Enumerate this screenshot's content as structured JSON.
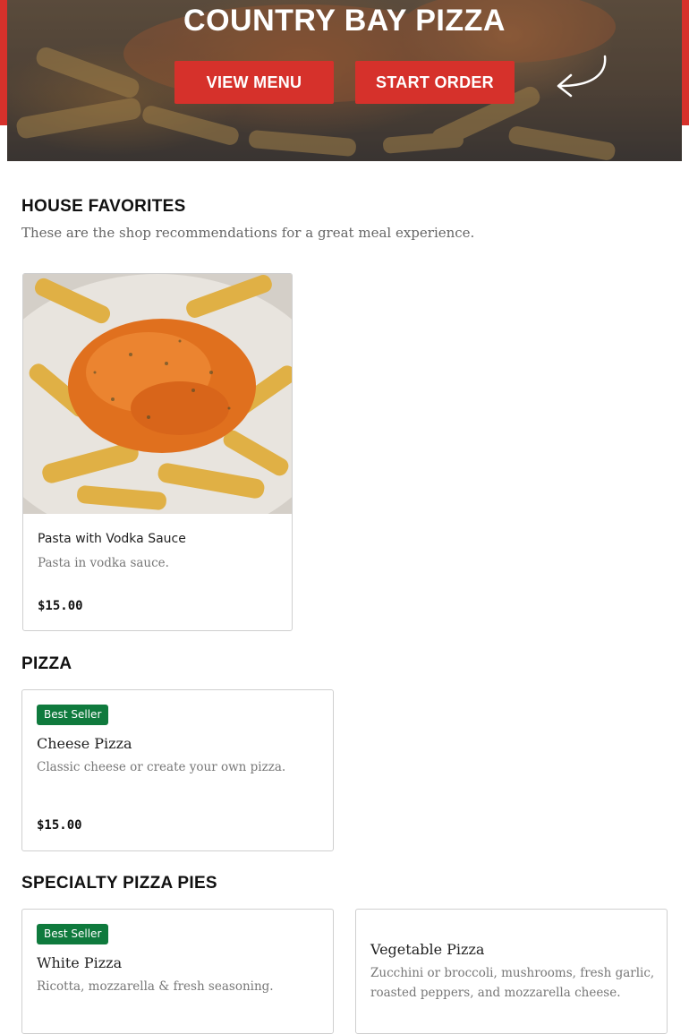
{
  "hero": {
    "title": "COUNTRY BAY PIZZA",
    "view_menu_label": "VIEW MENU",
    "start_order_label": "START ORDER"
  },
  "house_favorites": {
    "title": "HOUSE FAVORITES",
    "subtitle": "These are the shop recommendations for a great meal experience.",
    "items": [
      {
        "name": "Pasta with Vodka Sauce",
        "description": "Pasta in vodka sauce.",
        "price": "$15.00"
      }
    ]
  },
  "pizza": {
    "title": "PIZZA",
    "items": [
      {
        "badge": "Best Seller",
        "name": "Cheese Pizza",
        "description": "Classic cheese or create your own pizza.",
        "price": "$15.00"
      }
    ]
  },
  "specialty": {
    "title": "SPECIALTY PIZZA PIES",
    "items": [
      {
        "badge": "Best Seller",
        "name": "White Pizza",
        "description": "Ricotta, mozzarella & fresh seasoning."
      },
      {
        "name": "Vegetable Pizza",
        "description": "Zucchini or broccoli, mushrooms, fresh garlic, roasted peppers, and mozzarella cheese."
      }
    ]
  },
  "colors": {
    "brand_red": "#d6312b",
    "badge_green": "#0f7a3d"
  },
  "icons": [
    "curved-arrow-icon"
  ]
}
